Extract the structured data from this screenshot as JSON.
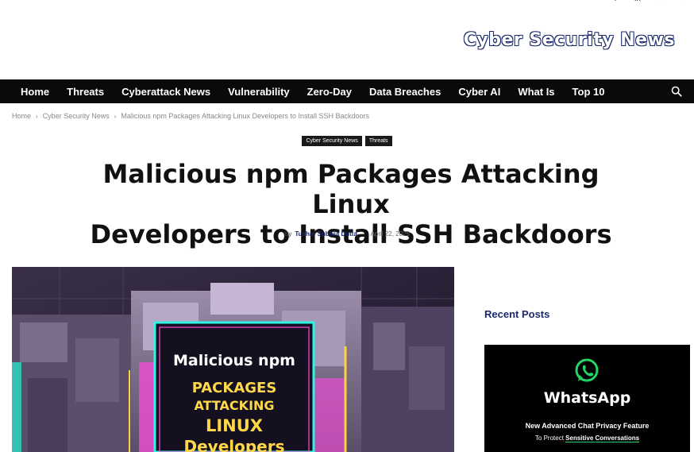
{
  "site": {
    "logo_text": "Cyber Security News",
    "social_icons": [
      "facebook-icon",
      "linkedin-icon",
      "rss-icon",
      "x-icon"
    ]
  },
  "nav": {
    "items": [
      {
        "label": "Home"
      },
      {
        "label": "Threats"
      },
      {
        "label": "Cyberattack News"
      },
      {
        "label": "Vulnerability"
      },
      {
        "label": "Zero-Day"
      },
      {
        "label": "Data Breaches"
      },
      {
        "label": "Cyber AI"
      },
      {
        "label": "What Is"
      },
      {
        "label": "Top 10"
      }
    ],
    "search_icon": "search-icon"
  },
  "breadcrumb": {
    "items": [
      "Home",
      "Cyber Security News",
      "Malicious npm Packages Attacking Linux Developers to Install SSH Backdoors"
    ]
  },
  "article": {
    "tags": [
      "Cyber Security News",
      "Threats"
    ],
    "title_line1": "Malicious npm Packages Attacking Linux",
    "title_line2": "Developers to Install SSH Backdoors",
    "by": "By",
    "author": "Tushar Subhra Dutta",
    "separator": "-",
    "date": "April 22, 2025",
    "image_text": {
      "line1": "Malicious npm",
      "line2": "PACKAGES",
      "line3": "ATTACKING",
      "line4": "LINUX",
      "line5": "Developers"
    }
  },
  "sidebar": {
    "recent_title": "Recent Posts",
    "thumb": {
      "brand": "WhatsApp",
      "line1": "New Advanced Chat Privacy Feature",
      "line2_prefix": "To Protect ",
      "line2_highlight": "Sensitive Conversations"
    }
  },
  "colors": {
    "navbar_bg": "#0a0a0a",
    "accent_blue": "#1a2a6a",
    "whatsapp_green": "#25d366"
  }
}
